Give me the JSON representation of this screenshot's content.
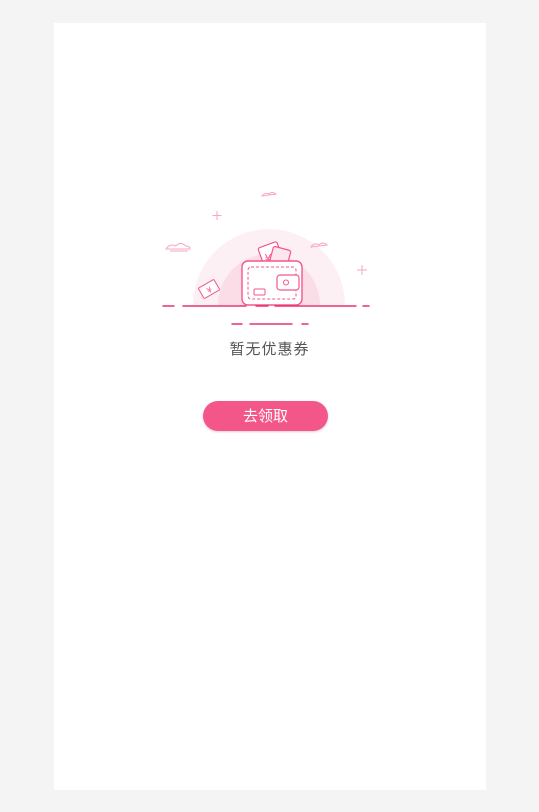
{
  "empty_state": {
    "message": "暂无优惠券",
    "illustration_icon": "wallet-with-coupons",
    "accent_color": "#f3578a",
    "soft_color": "#fde6ee"
  },
  "actions": {
    "claim_label": "去领取"
  }
}
